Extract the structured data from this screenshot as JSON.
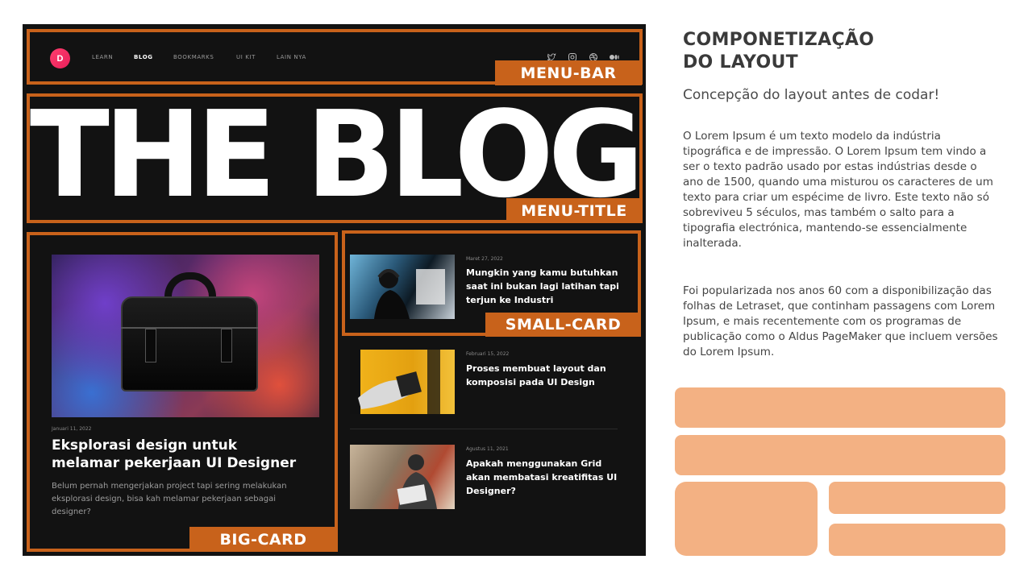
{
  "mockup": {
    "nav": {
      "logo_letter": "D",
      "links": [
        "LEARN",
        "BLOG",
        "BOOKMARKS",
        "UI KIT",
        "LAIN NYA"
      ],
      "active": "BLOG",
      "social_icons": [
        "twitter-icon",
        "instagram-icon",
        "dribbble-icon",
        "medium-icon"
      ]
    },
    "title": "THE BLOG",
    "big_card": {
      "date": "Januari 11, 2022",
      "headline": "Eksplorasi design untuk melamar pekerjaan UI Designer",
      "description": "Belum pernah mengerjakan project tapi sering melakukan eksplorasi design, bisa kah melamar pekerjaan sebagai designer?"
    },
    "small_cards": [
      {
        "date": "Maret 27, 2022",
        "headline": "Mungkin yang kamu butuhkan saat ini bukan lagi latihan tapi terjun ke Industri"
      },
      {
        "date": "Februari 15, 2022",
        "headline": "Proses membuat layout dan komposisi pada UI Design"
      },
      {
        "date": "Agustus 11, 2021",
        "headline": "Apakah menggunakan Grid akan membatasi kreatifitas UI Designer?"
      }
    ],
    "labels": {
      "menu_bar": "MENU-BAR",
      "menu_title": "MENU-TITLE",
      "small_card": "SMALL-CARD",
      "big_card": "BIG-CARD"
    },
    "colors": {
      "frame": "#c8621b",
      "background": "#121212",
      "accent": "#ff3d6e"
    }
  },
  "panel": {
    "heading_line1": "COMPONETIZAÇÃO",
    "heading_line2": "DO LAYOUT",
    "subheading": "Concepção do layout antes de codar!",
    "paragraph1": "O Lorem Ipsum é um texto modelo da indústria tipográfica e de impressão. O Lorem Ipsum tem vindo a ser o texto padrão usado por estas indústrias desde o ano de 1500, quando uma misturou os caracteres de um texto para criar um espécime de livro. Este texto não só sobreviveu 5 séculos, mas também o salto para a tipografia electrónica, mantendo-se essencialmente inalterada.",
    "paragraph2": "Foi popularizada nos anos 60 com a disponibilização das folhas de Letraset, que continham passagens com Lorem Ipsum, e mais recentemente com os programas de publicação como o Aldus PageMaker que incluem versões do Lorem Ipsum.",
    "block_color": "#f3b183"
  }
}
